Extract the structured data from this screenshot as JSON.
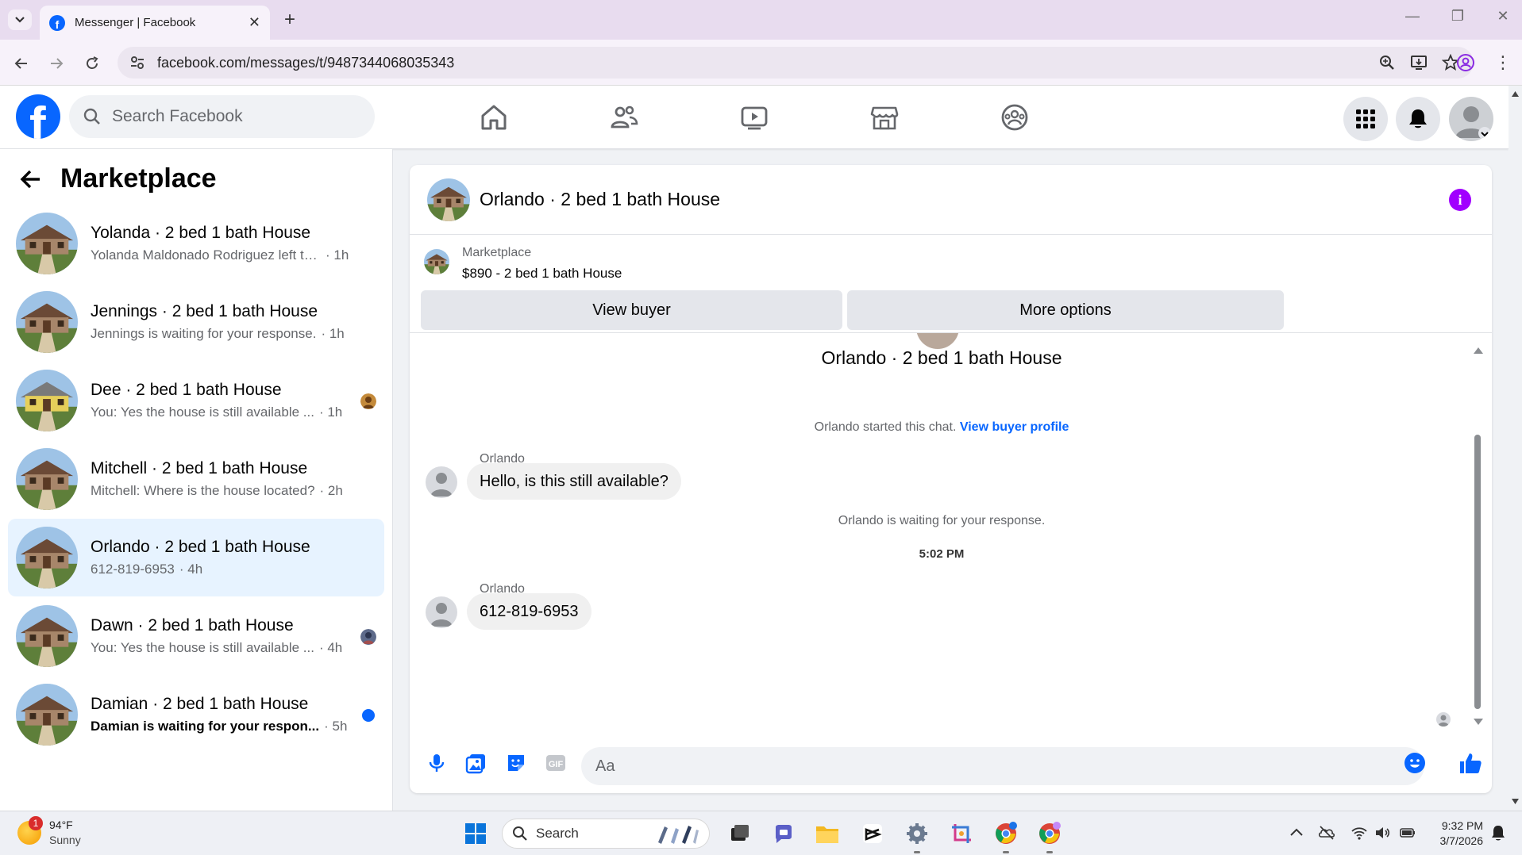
{
  "browser": {
    "tab_title": "Messenger | Facebook",
    "url": "facebook.com/messages/t/9487344068035343"
  },
  "header": {
    "search_placeholder": "Search Facebook"
  },
  "sidebar": {
    "title": "Marketplace",
    "conversations": [
      {
        "name": "Yolanda · 2 bed 1 bath House",
        "preview": "Yolanda Maldonado Rodriguez left th...",
        "time": "· 1h",
        "unread": false
      },
      {
        "name": "Jennings · 2 bed 1 bath House",
        "preview": "Jennings is waiting for your response.",
        "time": "· 1h",
        "unread": false
      },
      {
        "name": "Dee · 2 bed 1 bath House",
        "preview": "You: Yes the house is still available ...",
        "time": "· 1h",
        "unread": false
      },
      {
        "name": "Mitchell · 2 bed 1 bath House",
        "preview": "Mitchell: Where is the house located?",
        "time": "· 2h",
        "unread": false
      },
      {
        "name": "Orlando · 2 bed 1 bath House",
        "preview": "612-819-6953",
        "time": "· 4h",
        "unread": false,
        "active": true
      },
      {
        "name": "Dawn · 2 bed 1 bath House",
        "preview": "You: Yes the house is still available ...",
        "time": "· 4h",
        "unread": false
      },
      {
        "name": "Damian · 2 bed 1 bath House",
        "preview": "Damian is waiting for your respon...",
        "time": "· 5h",
        "unread": true
      }
    ]
  },
  "chat": {
    "title": "Orlando · 2 bed 1 bath House",
    "listing_source": "Marketplace",
    "listing_price": "$890 - 2 bed 1 bath House",
    "view_buyer_label": "View buyer",
    "more_options_label": "More options",
    "started_text": "Orlando started this chat.",
    "view_buyer_profile_label": "View buyer profile",
    "messages": [
      {
        "sender": "Orlando",
        "text": "Hello, is this still available?"
      },
      {
        "sender": "Orlando",
        "text": "612-819-6953"
      }
    ],
    "waiting_text": "Orlando is waiting for your response.",
    "timestamp": "5:02 PM",
    "composer_placeholder": "Aa"
  },
  "taskbar": {
    "weather_temp": "94°F",
    "weather_cond": "Sunny",
    "weather_badge": "1",
    "search_label": "Search",
    "time": "9:32 PM",
    "date": "3/7/2026"
  },
  "colors": {
    "brand": "#0866ff",
    "active_row": "#e7f3ff",
    "info_icon": "#a100ff"
  }
}
